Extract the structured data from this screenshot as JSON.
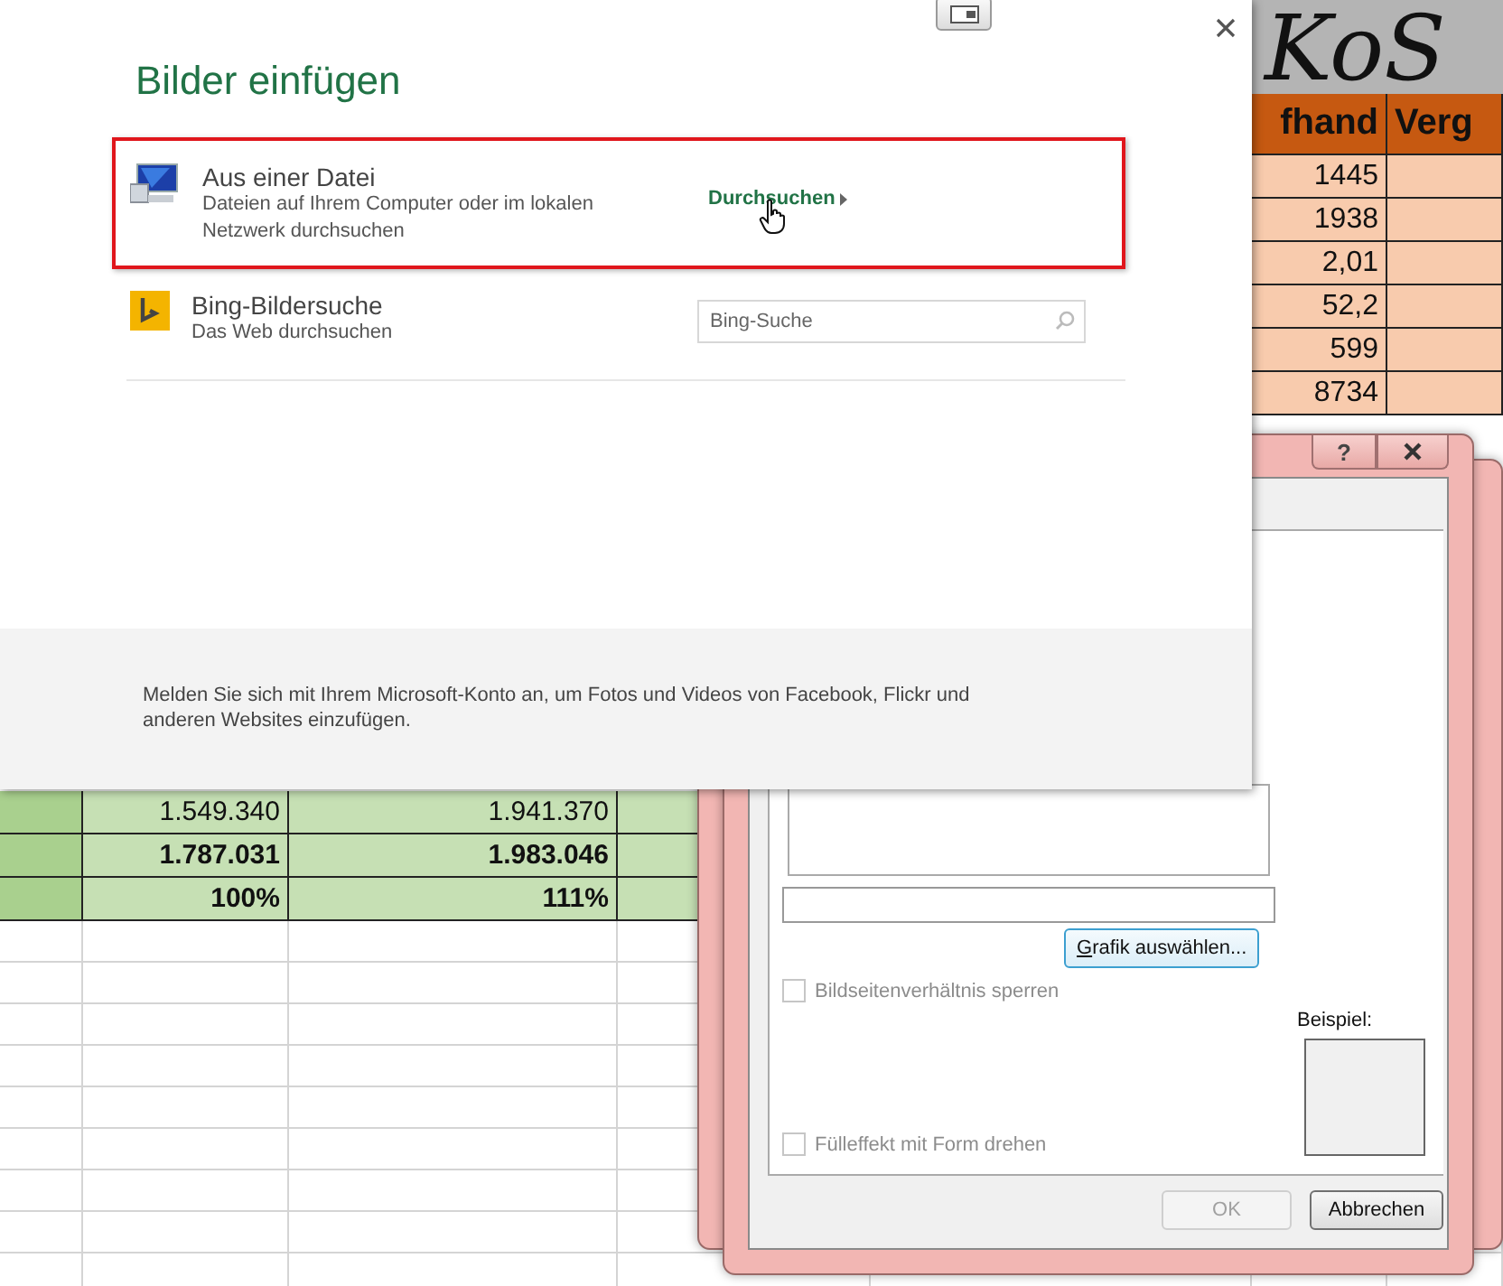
{
  "sheet": {
    "title_fragment": "KoS",
    "header": [
      "fhand",
      "Verg"
    ],
    "upper_rows": [
      "1445",
      "1938",
      "2,01",
      "52,2",
      "599",
      "8734"
    ],
    "lower_rows": [
      {
        "cells": [
          "1.549.340",
          "1.941.370"
        ],
        "bold": false
      },
      {
        "cells": [
          "1.787.031",
          "1.983.046"
        ],
        "bold": true
      },
      {
        "cells": [
          "100%",
          "111%"
        ],
        "bold": true
      }
    ]
  },
  "insert_pictures": {
    "title": "Bilder einfügen",
    "options": [
      {
        "kind": "file",
        "title": "Aus einer Datei",
        "description": "Dateien auf Ihrem Computer oder im lokalen Netzwerk durchsuchen",
        "action": "Durchsuchen",
        "selected": true
      },
      {
        "kind": "search",
        "title": "Bing-Bildersuche",
        "description": "Das Web durchsuchen",
        "placeholder": "Bing-Suche",
        "selected": false
      }
    ],
    "footer": "Melden Sie sich mit Ihrem Microsoft-Konto an, um Fotos und Videos von Facebook, Flickr und anderen Websites einzufügen."
  },
  "format_dialog": {
    "help_label": "?",
    "select_button": "Grafik auswählen...",
    "checkboxes": [
      {
        "label": "Bildseitenverhältnis sperren",
        "checked": false,
        "disabled": true
      },
      {
        "label": "Fülleffekt mit Form drehen",
        "checked": false,
        "disabled": true
      }
    ],
    "preview_label": "Beispiel:",
    "buttons": [
      {
        "label": "OK",
        "disabled": true
      },
      {
        "label": "Abbrechen",
        "disabled": false
      }
    ]
  }
}
